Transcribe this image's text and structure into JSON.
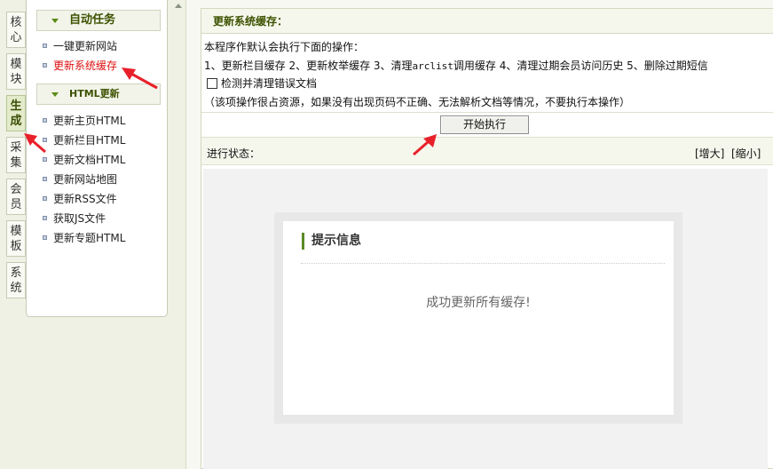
{
  "vtabs": [
    {
      "label": "核心",
      "active": false
    },
    {
      "label": "模块",
      "active": false
    },
    {
      "label": "生成",
      "active": true
    },
    {
      "label": "采集",
      "active": false
    },
    {
      "label": "会员",
      "active": false
    },
    {
      "label": "模板",
      "active": false
    },
    {
      "label": "系统",
      "active": false
    }
  ],
  "menu": {
    "section1_title": "自动任务",
    "section1_items": [
      "一键更新网站",
      "更新系统缓存"
    ],
    "section2_title": "HTML更新",
    "section2_items": [
      "更新主页HTML",
      "更新栏目HTML",
      "更新文档HTML",
      "更新网站地图",
      "更新RSS文件",
      "获取JS文件",
      "更新专题HTML"
    ]
  },
  "main": {
    "title": "更新系统缓存：",
    "intro": "本程序作默认会执行下面的操作：",
    "ops_prefix": "1、更新栏目缓存 2、更新枚举缓存 3、清理",
    "ops_code": "arclist",
    "ops_suffix": "调用缓存 4、清理过期会员访问历史 5、删除过期短信",
    "check_label": "检测并清理错误文档",
    "check_note": "（该项操作很占资源，如果没有出现页码不正确、无法解析文档等情况，不要执行本操作）",
    "run_button": "开始执行",
    "status_label": "进行状态：",
    "zoom_in": "[增大]",
    "zoom_out": "[缩小]"
  },
  "message": {
    "title": "提示信息",
    "text": "成功更新所有缓存!"
  },
  "colors": {
    "accent_green": "#3d5200",
    "highlight_red": "#dd1111",
    "annotation_arrow": "#e8202a"
  }
}
